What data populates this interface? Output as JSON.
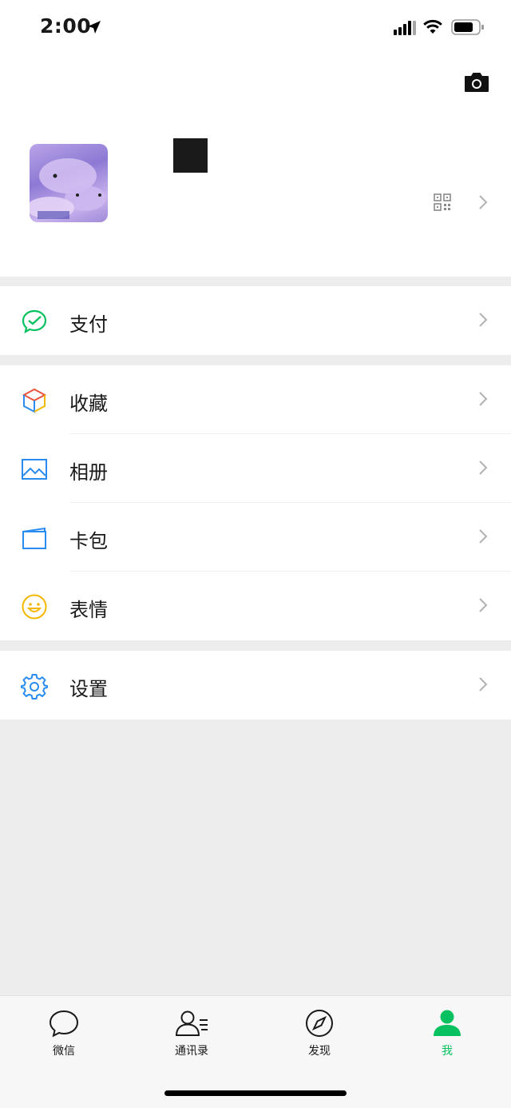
{
  "status_bar": {
    "time": "2:00"
  },
  "profile": {},
  "menu": {
    "pay": "支付",
    "favorites": "收藏",
    "album": "相册",
    "cards": "卡包",
    "stickers": "表情",
    "settings": "设置"
  },
  "tabs": [
    {
      "label": "微信",
      "icon": "chat-icon"
    },
    {
      "label": "通讯录",
      "icon": "contacts-icon"
    },
    {
      "label": "发现",
      "icon": "compass-icon"
    },
    {
      "label": "我",
      "icon": "person-icon"
    }
  ],
  "colors": {
    "accent": "#07c160",
    "background": "#ededed"
  }
}
